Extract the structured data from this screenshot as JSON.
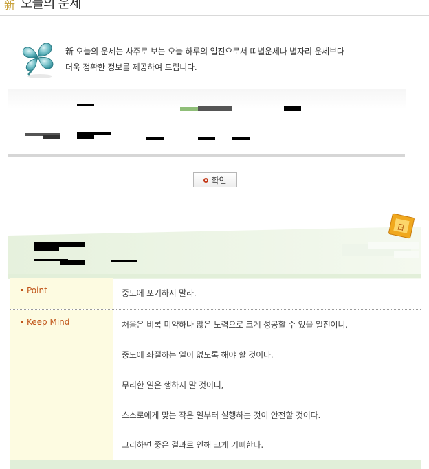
{
  "header": {
    "hanja": "新",
    "title": "오늘의 운세"
  },
  "intro": {
    "hanja": "新",
    "line1": " 오늘의 운세는 사주로 보는 오늘 하루의 일진으로서 띠별운세나 별자리 운세보다",
    "line2": "더욱 정확한 정보를 제공하여 드립니다."
  },
  "confirm_button": {
    "label": "확인"
  },
  "fortune": {
    "rows": [
      {
        "label": "Point",
        "lines": [
          "중도에 포기하지 말라."
        ]
      },
      {
        "label": "Keep Mind",
        "lines": [
          "처음은 비록 미약하나 많은 노력으로 크게 성공할 수 있을 일진이니,",
          "중도에 좌절하는 일이 없도록 해야 할 것이다.",
          "무리한 일은 행하지 말 것이니,",
          "스스로에게 맞는 작은 일부터 실행하는 것이 안전할 것이다.",
          "그리하면 좋은 결과로 인해 크게 기뻐한다."
        ]
      }
    ]
  },
  "colors": {
    "label_accent": "#c05418",
    "band_green": "#e2efd9",
    "label_bg": "#fdfbe1"
  },
  "icons": [
    "clover-icon",
    "notebook-icon",
    "confirm-bullet-icon"
  ]
}
